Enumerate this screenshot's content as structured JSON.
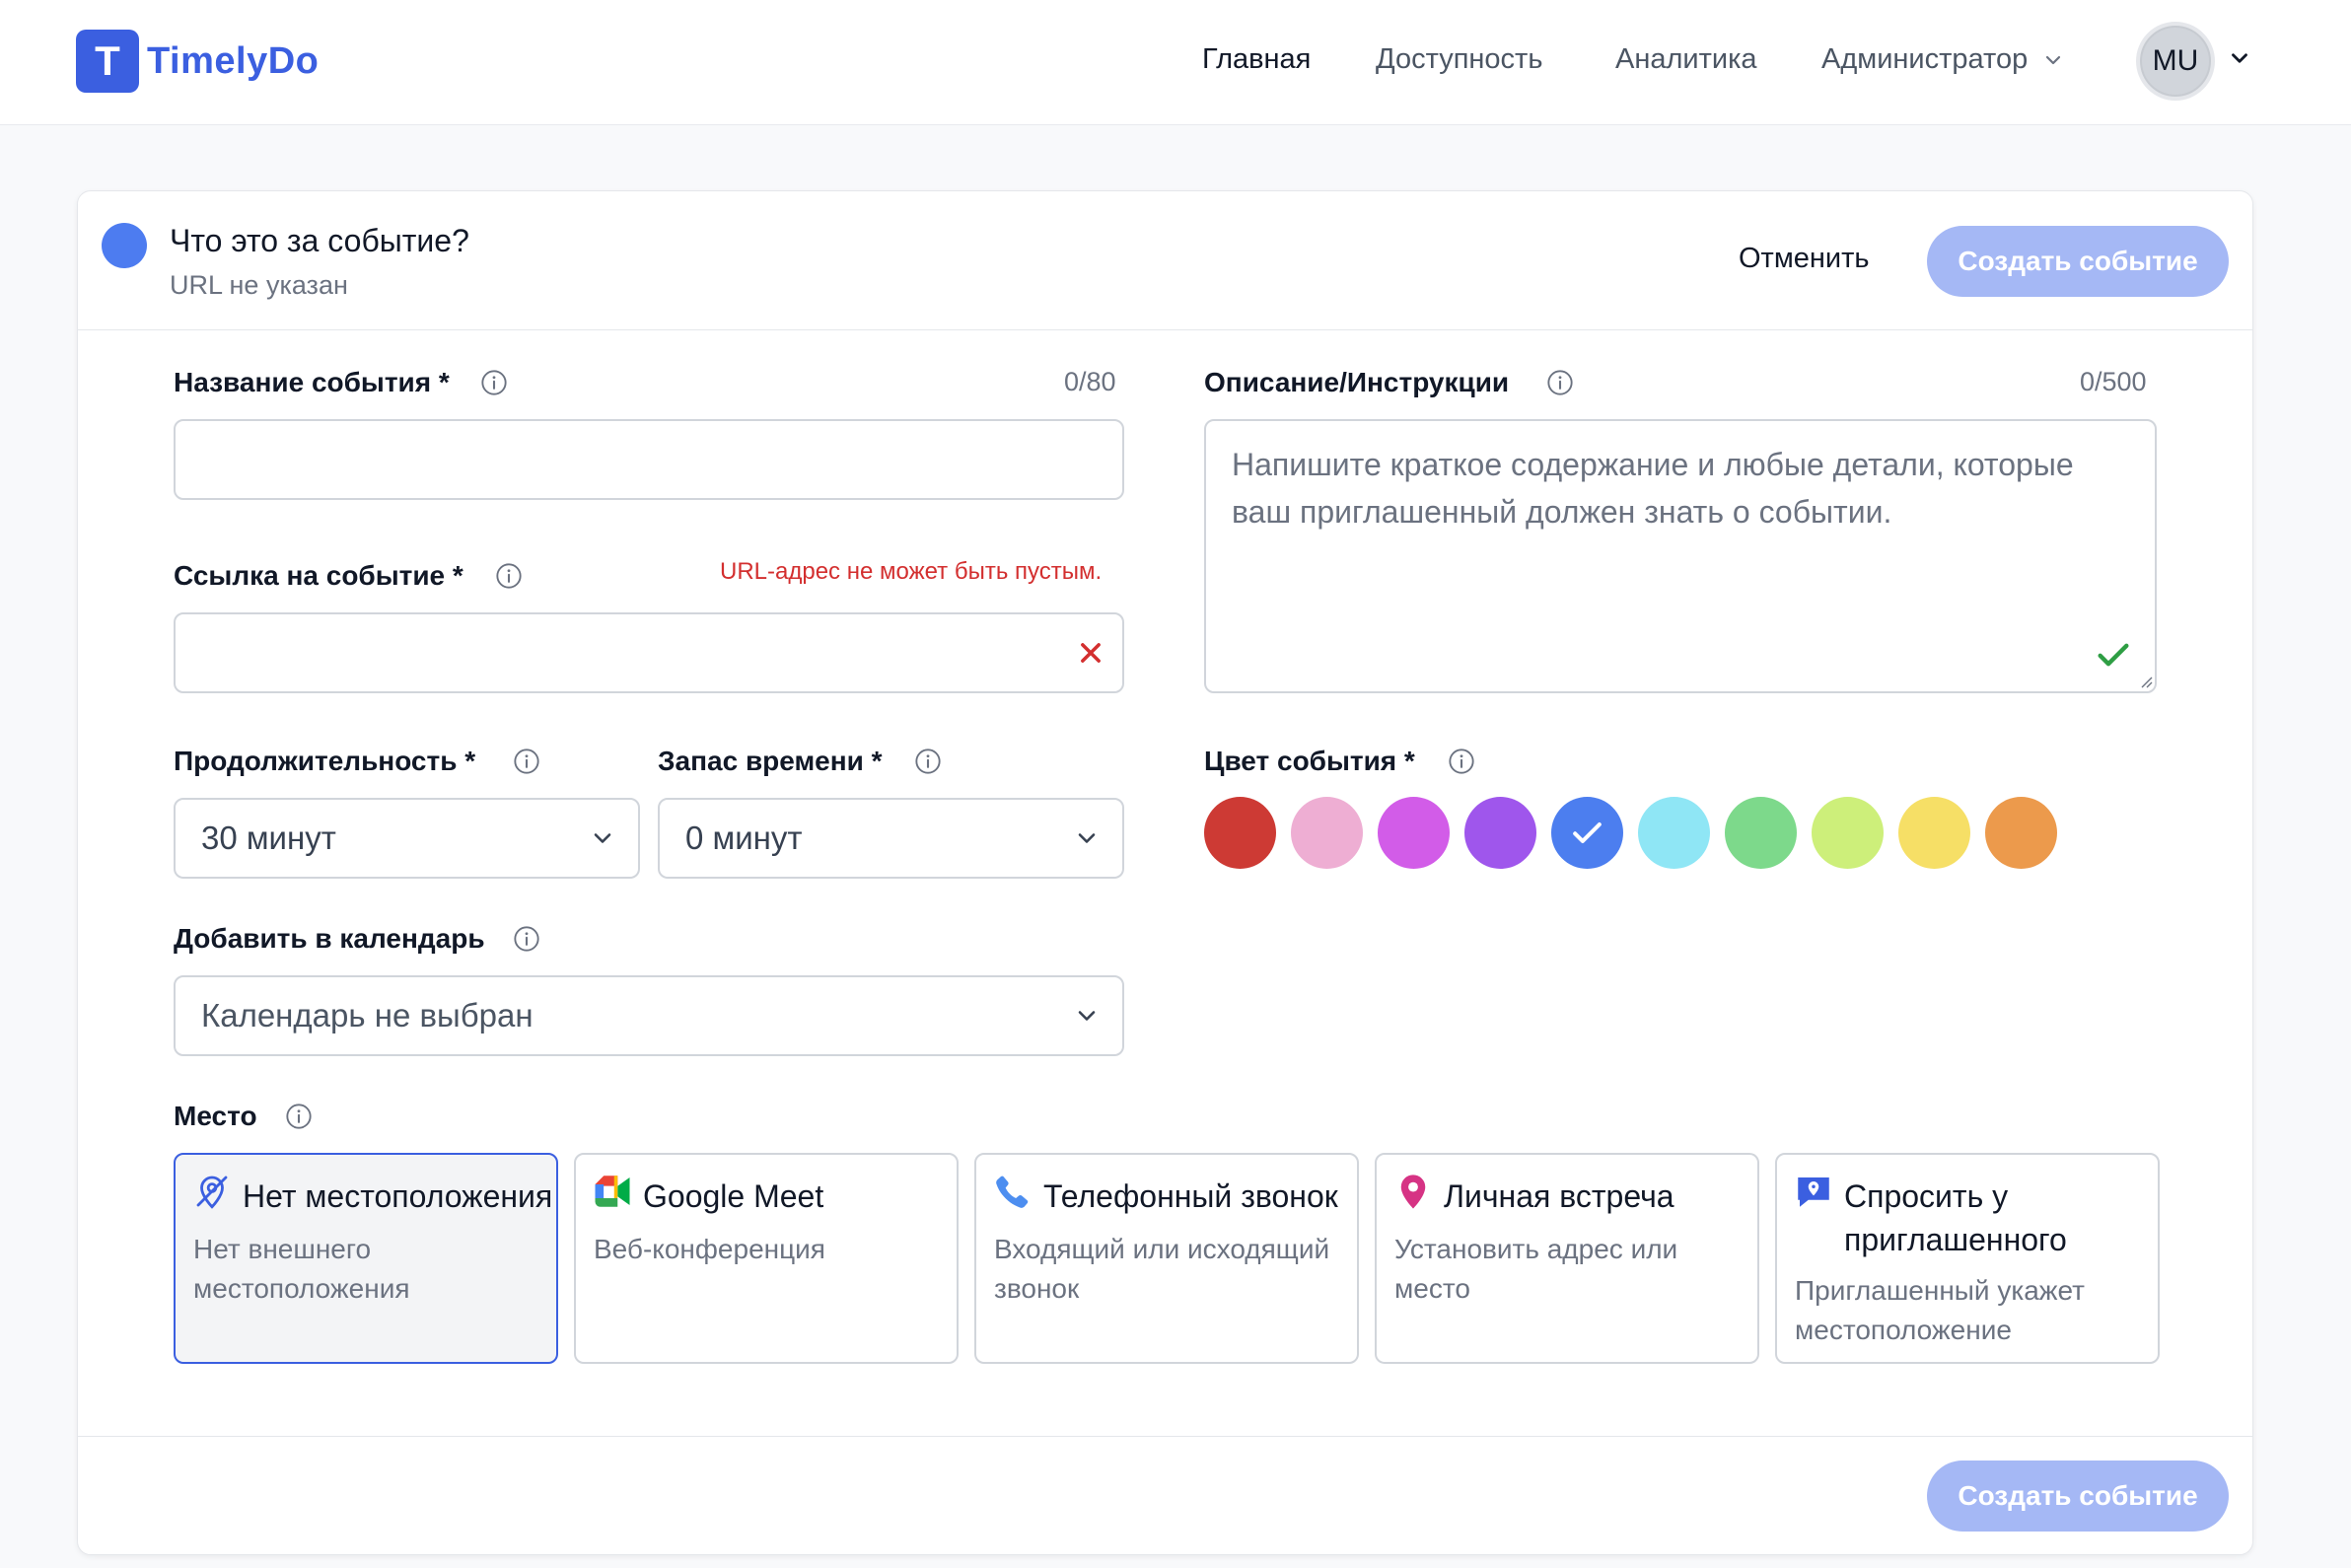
{
  "app": {
    "logo_letter": "T",
    "name": "TimelyDo"
  },
  "nav": {
    "items": [
      "Главная",
      "Доступность",
      "Аналитика",
      "Администратор"
    ],
    "avatar_initials": "MU"
  },
  "header": {
    "title": "Что это за событие?",
    "subtitle": "URL не указан",
    "cancel_label": "Отменить",
    "create_label": "Создать событие"
  },
  "form": {
    "event_name": {
      "label": "Название события *",
      "counter": "0/80",
      "value": ""
    },
    "event_link": {
      "label": "Ссылка на событие *",
      "error": "URL-адрес не может быть пустым.",
      "value": ""
    },
    "duration": {
      "label": "Продолжительность *",
      "value": "30 минут"
    },
    "buffer": {
      "label": "Запас времени *",
      "value": "0 минут"
    },
    "calendar": {
      "label": "Добавить в календарь",
      "value": "Календарь не выбран"
    },
    "description": {
      "label": "Описание/Инструкции",
      "counter": "0/500",
      "placeholder": "Напишите краткое содержание и любые детали, которые ваш приглашенный должен знать о событии."
    },
    "color": {
      "label": "Цвет события *",
      "swatches": [
        "#cd3a34",
        "#eeaed3",
        "#d25ce8",
        "#9f56ec",
        "#4c7eef",
        "#8fe6f5",
        "#7dd98b",
        "#cdef7a",
        "#f6df66",
        "#ec9a4c"
      ],
      "selected_index": 4
    },
    "location": {
      "label": "Место",
      "options": [
        {
          "title": "Нет местоположения",
          "desc": "Нет внешнего местоположения",
          "icon": "location-off-icon"
        },
        {
          "title": "Google Meet",
          "desc": "Веб-конференция",
          "icon": "google-meet-icon"
        },
        {
          "title": "Телефонный звонок",
          "desc": "Входящий или исходящий звонок",
          "icon": "phone-icon"
        },
        {
          "title": "Личная встреча",
          "desc": "Установить адрес или место",
          "icon": "map-pin-icon"
        },
        {
          "title": "Спросить у приглашенного",
          "desc": "Приглашенный укажет местоположение",
          "icon": "chat-location-icon"
        }
      ],
      "selected_index": 0
    }
  },
  "footer": {
    "create_label": "Создать событие"
  },
  "colors": {
    "brand": "#3b5fe0",
    "button_disabled": "#a5b8f5",
    "error": "#d32f2f",
    "success": "#2e9e44"
  }
}
